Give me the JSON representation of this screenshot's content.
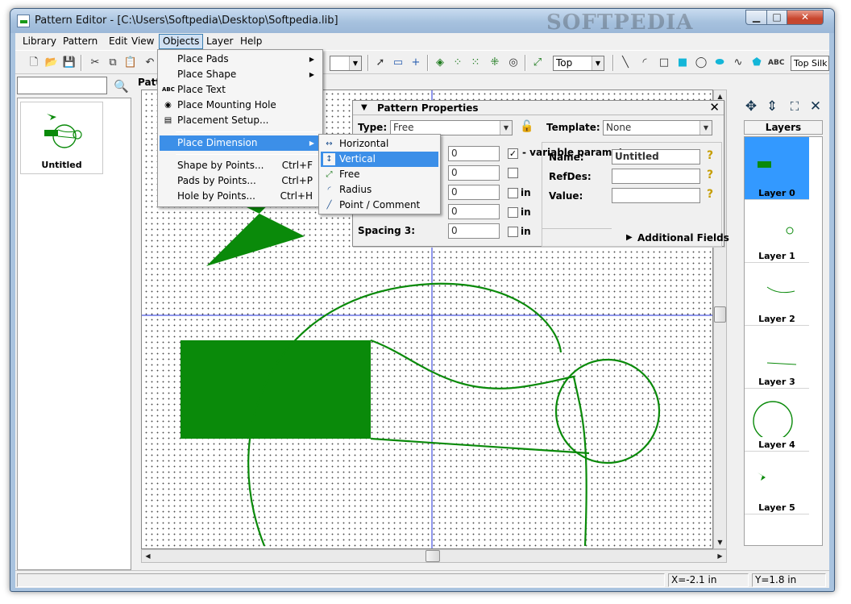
{
  "window": {
    "title": "Pattern Editor - [C:\\Users\\Softpedia\\Desktop\\Softpedia.lib]",
    "watermark": "SOFTPEDIA"
  },
  "menubar": {
    "items": [
      "Library",
      "Pattern",
      "Edit",
      "View",
      "Objects",
      "Layer",
      "Help"
    ],
    "active": "Objects"
  },
  "toolbar": {
    "side_combo": "Top",
    "layer_combo": "Top Silk",
    "text_tool": "ABC"
  },
  "library": {
    "pattern_name": "Untitled"
  },
  "canvas": {
    "tab_label": "Patte"
  },
  "objects_menu": {
    "items": [
      {
        "label": "Place Pads",
        "submenu": true
      },
      {
        "label": "Place Shape",
        "submenu": true
      },
      {
        "label": "Place Text",
        "icon": "ABC"
      },
      {
        "label": "Place Mounting Hole"
      },
      {
        "label": "Placement Setup..."
      },
      {
        "label": "Place Dimension",
        "submenu": true,
        "highlighted": true
      },
      {
        "label": "Shape by Points...",
        "shortcut": "Ctrl+F"
      },
      {
        "label": "Pads by Points...",
        "shortcut": "Ctrl+P"
      },
      {
        "label": "Hole by Points...",
        "shortcut": "Ctrl+H"
      }
    ]
  },
  "dimension_menu": {
    "items": [
      {
        "label": "Horizontal",
        "icon": "horizontal-dimension-icon"
      },
      {
        "label": "Vertical",
        "icon": "vertical-dimension-icon",
        "highlighted": true
      },
      {
        "label": "Free",
        "icon": "free-dimension-icon"
      },
      {
        "label": "Radius",
        "icon": "radius-dimension-icon"
      },
      {
        "label": "Point / Comment",
        "icon": "point-comment-icon"
      }
    ]
  },
  "pattern_properties": {
    "title": "Pattern Properties",
    "type_label": "Type:",
    "type_value": "Free",
    "template_label": "Template:",
    "template_value": "None",
    "variable_parameter_label": "- variable parameter",
    "variable_parameter_checked": true,
    "field_values": [
      "0",
      "0",
      "0",
      "0",
      "0"
    ],
    "in_label": "in",
    "spacing3_label": "Spacing 3:",
    "name_label": "Name:",
    "name_value": "Untitled",
    "refdes_label": "RefDes:",
    "refdes_value": "",
    "value_label": "Value:",
    "value_value": "",
    "additional_fields": "Additional Fields",
    "colors": {
      "lock": "#d8a800",
      "help": "#c69d00"
    }
  },
  "layers": {
    "header": "Layers",
    "items": [
      {
        "label": "Layer 0",
        "selected": true
      },
      {
        "label": "Layer 1"
      },
      {
        "label": "Layer 2"
      },
      {
        "label": "Layer 3"
      },
      {
        "label": "Layer 4"
      },
      {
        "label": "Layer 5"
      }
    ],
    "selection_color": "#3399ff"
  },
  "status": {
    "x": "X=-2.1 in",
    "y": "Y=1.8 in"
  },
  "colors": {
    "shape_green": "#0a8a0a",
    "axis_blue": "#1f2fd8",
    "menu_highlight": "#3c8fe8"
  }
}
